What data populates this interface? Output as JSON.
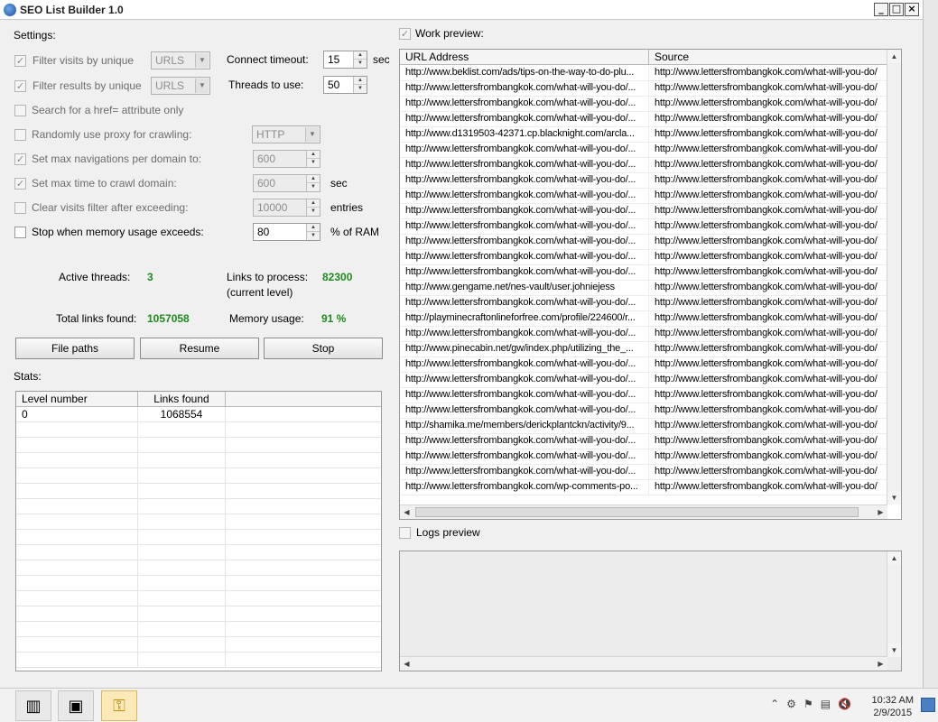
{
  "window": {
    "title": "SEO List Builder 1.0",
    "controls": {
      "minimize": "_",
      "maximize": "□",
      "close": "×"
    }
  },
  "settings": {
    "heading": "Settings:",
    "filter_visits": {
      "label": "Filter visits by unique",
      "checked": true,
      "combo": "URLS"
    },
    "filter_results": {
      "label": "Filter results by unique",
      "checked": true,
      "combo": "URLS"
    },
    "connect_timeout": {
      "label": "Connect timeout:",
      "value": "15",
      "unit": "sec"
    },
    "threads": {
      "label": "Threads to use:",
      "value": "50"
    },
    "href_only": {
      "label": "Search for a href= attribute only",
      "checked": false
    },
    "random_proxy": {
      "label": "Randomly use proxy for crawling:",
      "checked": false,
      "combo": "HTTP"
    },
    "max_nav": {
      "label": "Set max navigations per domain to:",
      "checked": true,
      "value": "600"
    },
    "max_time": {
      "label": "Set max time to crawl domain:",
      "checked": true,
      "value": "600",
      "unit": "sec"
    },
    "clear_visits": {
      "label": "Clear visits filter after exceeding:",
      "checked": false,
      "value": "10000",
      "unit": "entries"
    },
    "stop_memory": {
      "label": "Stop when memory usage exceeds:",
      "checked": false,
      "value": "80",
      "unit": "% of RAM"
    }
  },
  "stats_summary": {
    "active_threads_label": "Active threads:",
    "active_threads": "3",
    "links_to_process_label": "Links to process:",
    "links_to_process_sub": "(current level)",
    "links_to_process": "82300",
    "total_links_label": "Total links found:",
    "total_links": "1057058",
    "memory_label": "Memory usage:",
    "memory": "91 %"
  },
  "buttons": {
    "file_paths": "File paths",
    "resume": "Resume",
    "stop": "Stop"
  },
  "stats": {
    "heading": "Stats:",
    "columns": [
      "Level number",
      "Links found"
    ],
    "rows": [
      [
        "0",
        "1068554"
      ]
    ]
  },
  "work_preview": {
    "label": "Work preview:",
    "checked": true,
    "columns": [
      "URL Address",
      "Source"
    ],
    "rows": [
      [
        "http://www.beklist.com/ads/tips-on-the-way-to-do-plu...",
        "http://www.lettersfrombangkok.com/what-will-you-do/"
      ],
      [
        "http://www.lettersfrombangkok.com/what-will-you-do/...",
        "http://www.lettersfrombangkok.com/what-will-you-do/"
      ],
      [
        "http://www.lettersfrombangkok.com/what-will-you-do/...",
        "http://www.lettersfrombangkok.com/what-will-you-do/"
      ],
      [
        "http://www.lettersfrombangkok.com/what-will-you-do/...",
        "http://www.lettersfrombangkok.com/what-will-you-do/"
      ],
      [
        "http://www.d1319503-42371.cp.blacknight.com/arcla...",
        "http://www.lettersfrombangkok.com/what-will-you-do/"
      ],
      [
        "http://www.lettersfrombangkok.com/what-will-you-do/...",
        "http://www.lettersfrombangkok.com/what-will-you-do/"
      ],
      [
        "http://www.lettersfrombangkok.com/what-will-you-do/...",
        "http://www.lettersfrombangkok.com/what-will-you-do/"
      ],
      [
        "http://www.lettersfrombangkok.com/what-will-you-do/...",
        "http://www.lettersfrombangkok.com/what-will-you-do/"
      ],
      [
        "http://www.lettersfrombangkok.com/what-will-you-do/...",
        "http://www.lettersfrombangkok.com/what-will-you-do/"
      ],
      [
        "http://www.lettersfrombangkok.com/what-will-you-do/...",
        "http://www.lettersfrombangkok.com/what-will-you-do/"
      ],
      [
        "http://www.lettersfrombangkok.com/what-will-you-do/...",
        "http://www.lettersfrombangkok.com/what-will-you-do/"
      ],
      [
        "http://www.lettersfrombangkok.com/what-will-you-do/...",
        "http://www.lettersfrombangkok.com/what-will-you-do/"
      ],
      [
        "http://www.lettersfrombangkok.com/what-will-you-do/...",
        "http://www.lettersfrombangkok.com/what-will-you-do/"
      ],
      [
        "http://www.lettersfrombangkok.com/what-will-you-do/...",
        "http://www.lettersfrombangkok.com/what-will-you-do/"
      ],
      [
        "http://www.gengame.net/nes-vault/user.johniejess",
        "http://www.lettersfrombangkok.com/what-will-you-do/"
      ],
      [
        "http://www.lettersfrombangkok.com/what-will-you-do/...",
        "http://www.lettersfrombangkok.com/what-will-you-do/"
      ],
      [
        "http://playminecraftonlineforfree.com/profile/224600/r...",
        "http://www.lettersfrombangkok.com/what-will-you-do/"
      ],
      [
        "http://www.lettersfrombangkok.com/what-will-you-do/...",
        "http://www.lettersfrombangkok.com/what-will-you-do/"
      ],
      [
        "http://www.pinecabin.net/gw/index.php/utilizing_the_...",
        "http://www.lettersfrombangkok.com/what-will-you-do/"
      ],
      [
        "http://www.lettersfrombangkok.com/what-will-you-do/...",
        "http://www.lettersfrombangkok.com/what-will-you-do/"
      ],
      [
        "http://www.lettersfrombangkok.com/what-will-you-do/...",
        "http://www.lettersfrombangkok.com/what-will-you-do/"
      ],
      [
        "http://www.lettersfrombangkok.com/what-will-you-do/...",
        "http://www.lettersfrombangkok.com/what-will-you-do/"
      ],
      [
        "http://www.lettersfrombangkok.com/what-will-you-do/...",
        "http://www.lettersfrombangkok.com/what-will-you-do/"
      ],
      [
        "http://shamika.me/members/derickplantckn/activity/9...",
        "http://www.lettersfrombangkok.com/what-will-you-do/"
      ],
      [
        "http://www.lettersfrombangkok.com/what-will-you-do/...",
        "http://www.lettersfrombangkok.com/what-will-you-do/"
      ],
      [
        "http://www.lettersfrombangkok.com/what-will-you-do/...",
        "http://www.lettersfrombangkok.com/what-will-you-do/"
      ],
      [
        "http://www.lettersfrombangkok.com/what-will-you-do/...",
        "http://www.lettersfrombangkok.com/what-will-you-do/"
      ],
      [
        "http://www.lettersfrombangkok.com/wp-comments-po...",
        "http://www.lettersfrombangkok.com/what-will-you-do/"
      ]
    ]
  },
  "logs_preview": {
    "label": "Logs preview",
    "checked": false
  },
  "taskbar": {
    "time": "10:32 AM",
    "date": "2/9/2015",
    "icons": [
      "barcode-icon",
      "monitor-icon",
      "key-icon"
    ]
  }
}
